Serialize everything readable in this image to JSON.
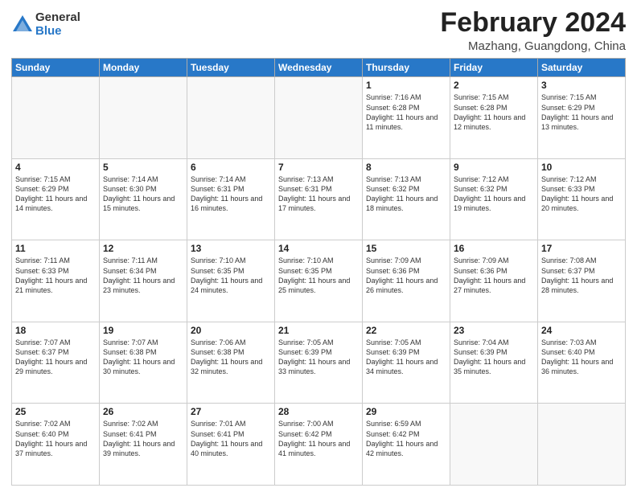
{
  "header": {
    "logo_general": "General",
    "logo_blue": "Blue",
    "title": "February 2024",
    "subtitle": "Mazhang, Guangdong, China"
  },
  "weekdays": [
    "Sunday",
    "Monday",
    "Tuesday",
    "Wednesday",
    "Thursday",
    "Friday",
    "Saturday"
  ],
  "weeks": [
    [
      {
        "day": "",
        "info": ""
      },
      {
        "day": "",
        "info": ""
      },
      {
        "day": "",
        "info": ""
      },
      {
        "day": "",
        "info": ""
      },
      {
        "day": "1",
        "info": "Sunrise: 7:16 AM\nSunset: 6:28 PM\nDaylight: 11 hours and 11 minutes."
      },
      {
        "day": "2",
        "info": "Sunrise: 7:15 AM\nSunset: 6:28 PM\nDaylight: 11 hours and 12 minutes."
      },
      {
        "day": "3",
        "info": "Sunrise: 7:15 AM\nSunset: 6:29 PM\nDaylight: 11 hours and 13 minutes."
      }
    ],
    [
      {
        "day": "4",
        "info": "Sunrise: 7:15 AM\nSunset: 6:29 PM\nDaylight: 11 hours and 14 minutes."
      },
      {
        "day": "5",
        "info": "Sunrise: 7:14 AM\nSunset: 6:30 PM\nDaylight: 11 hours and 15 minutes."
      },
      {
        "day": "6",
        "info": "Sunrise: 7:14 AM\nSunset: 6:31 PM\nDaylight: 11 hours and 16 minutes."
      },
      {
        "day": "7",
        "info": "Sunrise: 7:13 AM\nSunset: 6:31 PM\nDaylight: 11 hours and 17 minutes."
      },
      {
        "day": "8",
        "info": "Sunrise: 7:13 AM\nSunset: 6:32 PM\nDaylight: 11 hours and 18 minutes."
      },
      {
        "day": "9",
        "info": "Sunrise: 7:12 AM\nSunset: 6:32 PM\nDaylight: 11 hours and 19 minutes."
      },
      {
        "day": "10",
        "info": "Sunrise: 7:12 AM\nSunset: 6:33 PM\nDaylight: 11 hours and 20 minutes."
      }
    ],
    [
      {
        "day": "11",
        "info": "Sunrise: 7:11 AM\nSunset: 6:33 PM\nDaylight: 11 hours and 21 minutes."
      },
      {
        "day": "12",
        "info": "Sunrise: 7:11 AM\nSunset: 6:34 PM\nDaylight: 11 hours and 23 minutes."
      },
      {
        "day": "13",
        "info": "Sunrise: 7:10 AM\nSunset: 6:35 PM\nDaylight: 11 hours and 24 minutes."
      },
      {
        "day": "14",
        "info": "Sunrise: 7:10 AM\nSunset: 6:35 PM\nDaylight: 11 hours and 25 minutes."
      },
      {
        "day": "15",
        "info": "Sunrise: 7:09 AM\nSunset: 6:36 PM\nDaylight: 11 hours and 26 minutes."
      },
      {
        "day": "16",
        "info": "Sunrise: 7:09 AM\nSunset: 6:36 PM\nDaylight: 11 hours and 27 minutes."
      },
      {
        "day": "17",
        "info": "Sunrise: 7:08 AM\nSunset: 6:37 PM\nDaylight: 11 hours and 28 minutes."
      }
    ],
    [
      {
        "day": "18",
        "info": "Sunrise: 7:07 AM\nSunset: 6:37 PM\nDaylight: 11 hours and 29 minutes."
      },
      {
        "day": "19",
        "info": "Sunrise: 7:07 AM\nSunset: 6:38 PM\nDaylight: 11 hours and 30 minutes."
      },
      {
        "day": "20",
        "info": "Sunrise: 7:06 AM\nSunset: 6:38 PM\nDaylight: 11 hours and 32 minutes."
      },
      {
        "day": "21",
        "info": "Sunrise: 7:05 AM\nSunset: 6:39 PM\nDaylight: 11 hours and 33 minutes."
      },
      {
        "day": "22",
        "info": "Sunrise: 7:05 AM\nSunset: 6:39 PM\nDaylight: 11 hours and 34 minutes."
      },
      {
        "day": "23",
        "info": "Sunrise: 7:04 AM\nSunset: 6:39 PM\nDaylight: 11 hours and 35 minutes."
      },
      {
        "day": "24",
        "info": "Sunrise: 7:03 AM\nSunset: 6:40 PM\nDaylight: 11 hours and 36 minutes."
      }
    ],
    [
      {
        "day": "25",
        "info": "Sunrise: 7:02 AM\nSunset: 6:40 PM\nDaylight: 11 hours and 37 minutes."
      },
      {
        "day": "26",
        "info": "Sunrise: 7:02 AM\nSunset: 6:41 PM\nDaylight: 11 hours and 39 minutes."
      },
      {
        "day": "27",
        "info": "Sunrise: 7:01 AM\nSunset: 6:41 PM\nDaylight: 11 hours and 40 minutes."
      },
      {
        "day": "28",
        "info": "Sunrise: 7:00 AM\nSunset: 6:42 PM\nDaylight: 11 hours and 41 minutes."
      },
      {
        "day": "29",
        "info": "Sunrise: 6:59 AM\nSunset: 6:42 PM\nDaylight: 11 hours and 42 minutes."
      },
      {
        "day": "",
        "info": ""
      },
      {
        "day": "",
        "info": ""
      }
    ]
  ]
}
